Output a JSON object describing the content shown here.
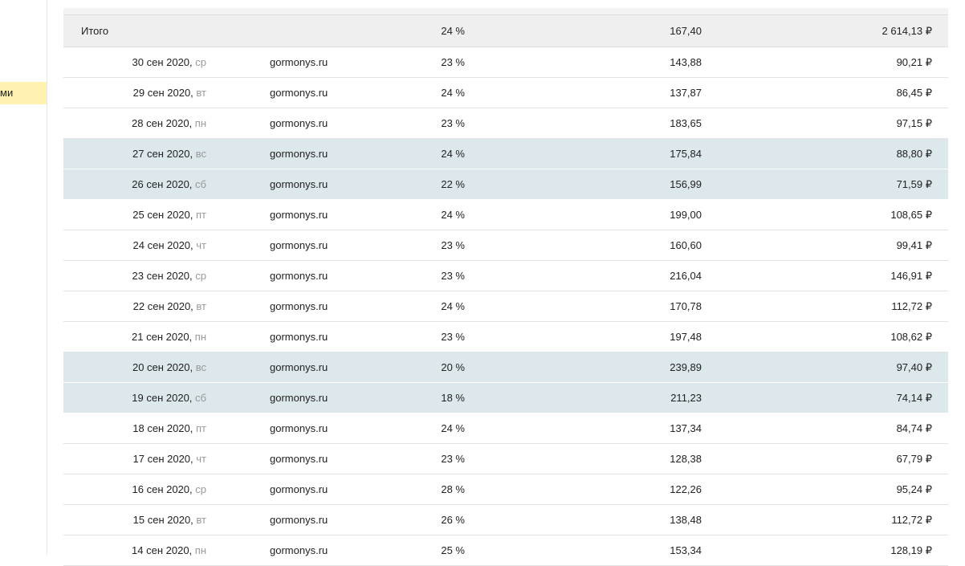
{
  "sidebar": {
    "active_item_label": "ми",
    "active_item_color": "#fff2b0"
  },
  "table": {
    "weekend_row_color": "#dde8ec",
    "total": {
      "label": "Итого",
      "percent": "24 %",
      "value": "167,40",
      "sum": "2 614,13 ₽"
    },
    "rows": [
      {
        "date": "30 сен 2020,",
        "dow": "ср",
        "site": "gormonys.ru",
        "percent": "23 %",
        "value": "143,88",
        "sum": "90,21 ₽",
        "weekend": false
      },
      {
        "date": "29 сен 2020,",
        "dow": "вт",
        "site": "gormonys.ru",
        "percent": "24 %",
        "value": "137,87",
        "sum": "86,45 ₽",
        "weekend": false
      },
      {
        "date": "28 сен 2020,",
        "dow": "пн",
        "site": "gormonys.ru",
        "percent": "23 %",
        "value": "183,65",
        "sum": "97,15 ₽",
        "weekend": false
      },
      {
        "date": "27 сен 2020,",
        "dow": "вс",
        "site": "gormonys.ru",
        "percent": "24 %",
        "value": "175,84",
        "sum": "88,80 ₽",
        "weekend": true
      },
      {
        "date": "26 сен 2020,",
        "dow": "сб",
        "site": "gormonys.ru",
        "percent": "22 %",
        "value": "156,99",
        "sum": "71,59 ₽",
        "weekend": true
      },
      {
        "date": "25 сен 2020,",
        "dow": "пт",
        "site": "gormonys.ru",
        "percent": "24 %",
        "value": "199,00",
        "sum": "108,65 ₽",
        "weekend": false
      },
      {
        "date": "24 сен 2020,",
        "dow": "чт",
        "site": "gormonys.ru",
        "percent": "23 %",
        "value": "160,60",
        "sum": "99,41 ₽",
        "weekend": false
      },
      {
        "date": "23 сен 2020,",
        "dow": "ср",
        "site": "gormonys.ru",
        "percent": "23 %",
        "value": "216,04",
        "sum": "146,91 ₽",
        "weekend": false
      },
      {
        "date": "22 сен 2020,",
        "dow": "вт",
        "site": "gormonys.ru",
        "percent": "24 %",
        "value": "170,78",
        "sum": "112,72 ₽",
        "weekend": false
      },
      {
        "date": "21 сен 2020,",
        "dow": "пн",
        "site": "gormonys.ru",
        "percent": "23 %",
        "value": "197,48",
        "sum": "108,62 ₽",
        "weekend": false
      },
      {
        "date": "20 сен 2020,",
        "dow": "вс",
        "site": "gormonys.ru",
        "percent": "20 %",
        "value": "239,89",
        "sum": "97,40 ₽",
        "weekend": true
      },
      {
        "date": "19 сен 2020,",
        "dow": "сб",
        "site": "gormonys.ru",
        "percent": "18 %",
        "value": "211,23",
        "sum": "74,14 ₽",
        "weekend": true
      },
      {
        "date": "18 сен 2020,",
        "dow": "пт",
        "site": "gormonys.ru",
        "percent": "24 %",
        "value": "137,34",
        "sum": "84,74 ₽",
        "weekend": false
      },
      {
        "date": "17 сен 2020,",
        "dow": "чт",
        "site": "gormonys.ru",
        "percent": "23 %",
        "value": "128,38",
        "sum": "67,79 ₽",
        "weekend": false
      },
      {
        "date": "16 сен 2020,",
        "dow": "ср",
        "site": "gormonys.ru",
        "percent": "28 %",
        "value": "122,26",
        "sum": "95,24 ₽",
        "weekend": false
      },
      {
        "date": "15 сен 2020,",
        "dow": "вт",
        "site": "gormonys.ru",
        "percent": "26 %",
        "value": "138,48",
        "sum": "112,72 ₽",
        "weekend": false
      },
      {
        "date": "14 сен 2020,",
        "dow": "пн",
        "site": "gormonys.ru",
        "percent": "25 %",
        "value": "153,34",
        "sum": "128,19 ₽",
        "weekend": false
      }
    ]
  }
}
